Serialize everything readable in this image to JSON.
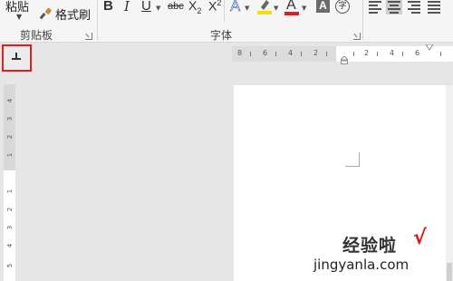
{
  "ribbon": {
    "clipboard": {
      "paste_label": "粘贴",
      "format_painter_label": "格式刷",
      "group_label": "剪贴板"
    },
    "font": {
      "bold": "B",
      "italic": "I",
      "underline": "U",
      "strikethrough": "abc",
      "subscript_base": "X",
      "subscript_mark": "2",
      "superscript_base": "X",
      "superscript_mark": "2",
      "text_effect": "A",
      "font_color": "A",
      "char_shading": "A",
      "enclose": "字",
      "group_label": "字体",
      "highlight_color": "#f5e100",
      "font_color_bar": "#e02020"
    }
  },
  "tab_selector_icon": "left-tab-icon",
  "hruler": {
    "labels": [
      "8",
      "6",
      "4",
      "2",
      "",
      "2",
      "4",
      "6"
    ]
  },
  "vruler": {
    "labels": [
      "4",
      "3",
      "2",
      "1",
      "1",
      "2",
      "3",
      "4",
      "5"
    ]
  },
  "watermark": {
    "main": "经验啦",
    "check": "√",
    "url": "jingyanla.com"
  },
  "colors": {
    "highlight_box": "#e02020",
    "ribbon_bg": "#f5f5f5",
    "canvas_bg": "#e6e6e6"
  }
}
